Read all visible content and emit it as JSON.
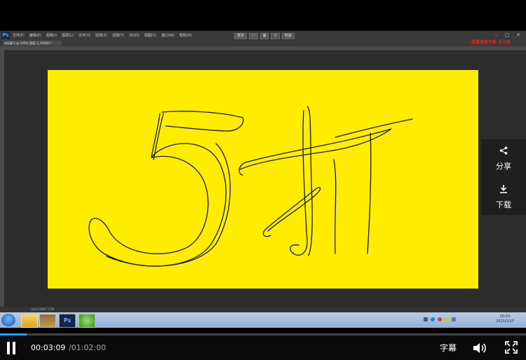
{
  "photoshop": {
    "logo": "Ps",
    "menu": [
      "文件(F)",
      "编辑(E)",
      "图像(I)",
      "图层(L)",
      "文字(Y)",
      "选择(S)",
      "滤镜(T)",
      "3D(D)",
      "视图(V)",
      "窗口(W)",
      "帮助(H)"
    ],
    "workspace_buttons": [
      "基本",
      "",
      "",
      "绘画"
    ],
    "doc_tab": "未标题-1 @ 100% (图层 1, RGB/8) *",
    "overlay_text": "屏幕录像专家 未注册",
    "status_text": "文档:518K/7.13M",
    "canvas_color": "#ffed00"
  },
  "taskbar": {
    "clock_time": "20:03",
    "clock_date": "2015/1/27"
  },
  "side_panel": {
    "share_label": "分享",
    "share_icon": "share-icon",
    "download_label": "下载",
    "download_icon": "download-icon"
  },
  "player": {
    "current_time": "00:03:09",
    "total_time": "/01:02:00",
    "progress": 0.0508,
    "subtitle_label": "字幕",
    "accent": "#1e9dff"
  }
}
